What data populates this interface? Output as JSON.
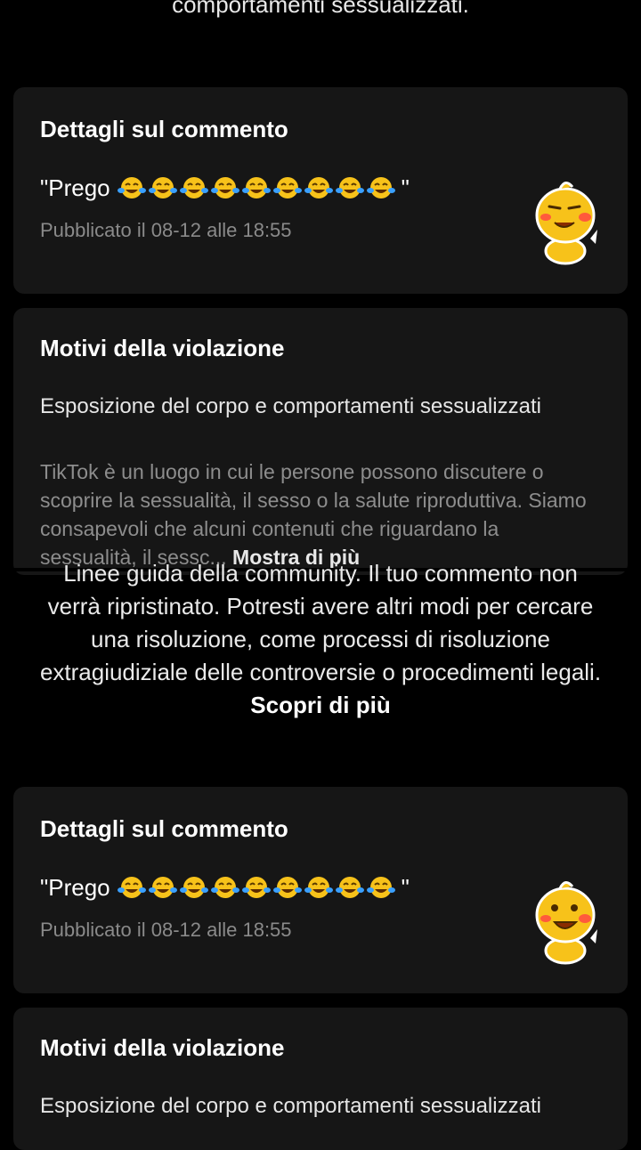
{
  "top_text": "comportamenti sessualizzati.",
  "card1": {
    "title": "Dettagli sul commento",
    "comment_prefix": "\"Prego",
    "comment_suffix": "\"",
    "emoji_count": 9,
    "published": "Pubblicato il 08-12 alle 18:55"
  },
  "reason1": {
    "title": "Motivi della violazione",
    "category": "Esposizione del corpo e comportamenti sessualizzati",
    "description": "TikTok è un luogo in cui le persone possono discutere o scoprire la sessualità, il sesso o la salute riproduttiva. Siamo consapevoli che alcuni contenuti che riguardano la sessualità, il sessc...",
    "show_more": "Mostra di più"
  },
  "middle": {
    "text": "Linee guida della community. Il tuo commento non verrà ripristinato. Potresti avere altri modi per cercare una risoluzione, come processi di risoluzione extragiudiziale delle controversie o procedimenti legali.",
    "learn_more": "Scopri di più"
  },
  "card2": {
    "title": "Dettagli sul commento",
    "comment_prefix": "\"Prego",
    "comment_suffix": "\"",
    "emoji_count": 9,
    "published": "Pubblicato il 08-12 alle 18:55"
  },
  "reason2": {
    "title": "Motivi della violazione",
    "category": "Esposizione del corpo e comportamenti sessualizzati"
  },
  "colors": {
    "background": "#000000",
    "card": "#161616",
    "muted": "#8a8a8a",
    "emoji_face": "#f7c21a",
    "tear": "#3aa0ff"
  },
  "icons": {
    "emoji": "face-with-tears-of-joy-icon",
    "sticker": "yellow-mascot-sticker-icon"
  }
}
